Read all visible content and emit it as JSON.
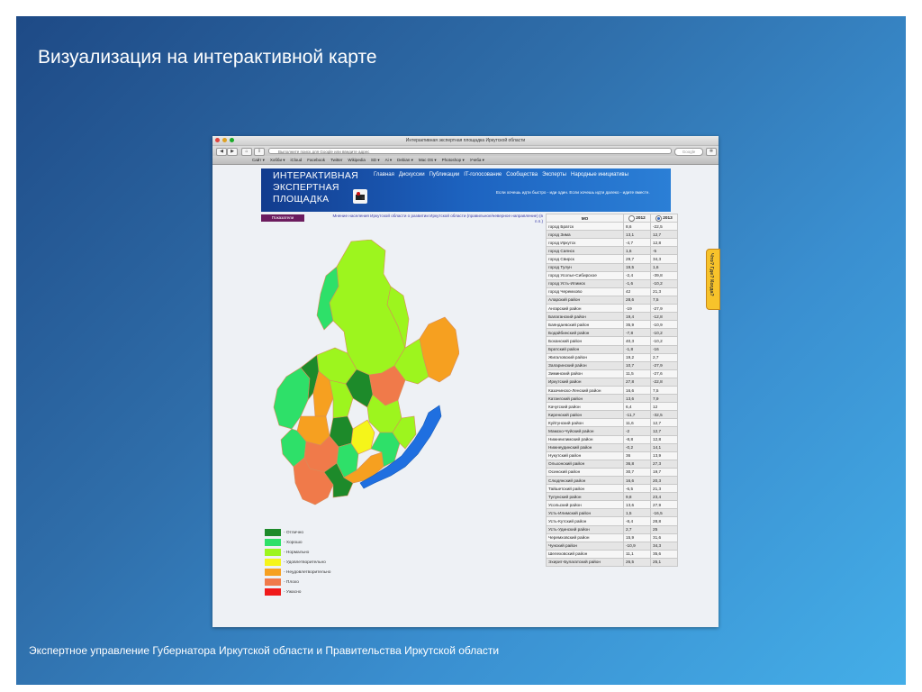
{
  "slide": {
    "title": "Визуализация на интерактивной карте",
    "footer": "Экспертное управление Губернатора Иркутской области и Правительства Иркутской области"
  },
  "browser": {
    "window_title": "Интерактивная экспертная площадка Иркутской области",
    "url_placeholder": "Выполните поиск для Google или введите адрес",
    "search_placeholder": "Google",
    "bookmarks": [
      "Сайт ▾",
      "Хобби ▾",
      "iCloud",
      "Facebook",
      "Twitter",
      "Wikipedia",
      "SD ▾",
      "Ai ▾",
      "Debian ▾",
      "Mac OS ▾",
      "Photoshop ▾",
      "Учеба ▾"
    ]
  },
  "site": {
    "logo_line1": "ИНТЕРАКТИВНАЯ",
    "logo_line2": "ЭКСПЕРТНАЯ",
    "logo_line3": "ПЛОЩАДКА",
    "nav": [
      "Главная",
      "Дискуссии",
      "Публикации",
      "IT-голосование",
      "Сообщества",
      "Эксперты",
      "Народные инициативы"
    ],
    "quote": "Если хочешь идти быстро - иди один. Если хочешь идти далеко - идите вместе.",
    "indicators_button": "Показатели",
    "map_heading": "Мнение населения Иркутской области о развитии Иркутской области (правильное/неверное направление) (в п.п.)",
    "side_tab": "Что? Где? Когда?"
  },
  "legend": [
    {
      "label": "- Отлично",
      "color": "#1d8a2a"
    },
    {
      "label": "- Хорошо",
      "color": "#2ee069"
    },
    {
      "label": "- Нормально",
      "color": "#9df51e"
    },
    {
      "label": "- Удовлетворительно",
      "color": "#f5f51a"
    },
    {
      "label": "- Неудовлетворительно",
      "color": "#f6a020"
    },
    {
      "label": "- Плохо",
      "color": "#f07a4a"
    },
    {
      "label": "- Ужасно",
      "color": "#f01a1a"
    }
  ],
  "table": {
    "header": {
      "mo": "МО",
      "y2012": "2012",
      "y2013": "2013"
    },
    "rows": [
      [
        "город Братск",
        "8,6",
        "-22,5"
      ],
      [
        "город Зима",
        "13,1",
        "12,7"
      ],
      [
        "город Иркутск",
        "-4,7",
        "12,8"
      ],
      [
        "город Саянск",
        "1,6",
        "-5"
      ],
      [
        "город Свирск",
        "29,7",
        "34,3"
      ],
      [
        "город Тулун",
        "19,5",
        "1,6"
      ],
      [
        "город Усолье-Сибирское",
        "-2,4",
        "-39,8"
      ],
      [
        "город Усть-Илимск",
        "-1,6",
        "-10,2"
      ],
      [
        "город Черемхово",
        "42",
        "21,3"
      ],
      [
        "Аларский район",
        "28,6",
        "7,5"
      ],
      [
        "Ангарский район",
        "-19",
        "-27,9"
      ],
      [
        "Балаганский район",
        "19,4",
        "-12,8"
      ],
      [
        "Баяндаевский район",
        "35,9",
        "-10,9"
      ],
      [
        "Бодайбинский район",
        "-7,8",
        "-10,2"
      ],
      [
        "Боханский район",
        "40,3",
        "-10,2"
      ],
      [
        "Братский район",
        "-1,8",
        "-16"
      ],
      [
        "Жигаловский район",
        "19,2",
        "2,7"
      ],
      [
        "Заларинский район",
        "10,7",
        "-27,9"
      ],
      [
        "Зиминский район",
        "11,5",
        "-27,6"
      ],
      [
        "Иркутский район",
        "27,8",
        "-22,8"
      ],
      [
        "Казачинско-Ленский район",
        "16,6",
        "7,5"
      ],
      [
        "Катангский район",
        "13,6",
        "7,9"
      ],
      [
        "Качугский район",
        "6,4",
        "12"
      ],
      [
        "Киренский район",
        "-11,7",
        "-32,5"
      ],
      [
        "Куйтунский район",
        "11,6",
        "12,7"
      ],
      [
        "Мамско-Чуйский район",
        "-2",
        "12,7"
      ],
      [
        "Нижнеилимский район",
        "-8,8",
        "12,8"
      ],
      [
        "Нижнеудинский район",
        "-0,2",
        "14,1"
      ],
      [
        "Нукутский район",
        "36",
        "13,9"
      ],
      [
        "Ольхонский район",
        "36,8",
        "27,3"
      ],
      [
        "Осинский район",
        "30,7",
        "19,7"
      ],
      [
        "Слюдянский район",
        "16,6",
        "20,3"
      ],
      [
        "Тайшетский район",
        "-6,5",
        "21,3"
      ],
      [
        "Тулунский район",
        "9,8",
        "23,4"
      ],
      [
        "Усольский район",
        "13,6",
        "27,9"
      ],
      [
        "Усть-Илимский район",
        "1,5",
        "-16,5"
      ],
      [
        "Усть-Кутский район",
        "-8,4",
        "28,8"
      ],
      [
        "Усть-Удинский район",
        "2,7",
        "25"
      ],
      [
        "Черемховский район",
        "15,9",
        "31,6"
      ],
      [
        "Чунский район",
        "-10,9",
        "34,3"
      ],
      [
        "Шелеховский район",
        "11,1",
        "35,6"
      ],
      [
        "Эхирит-Булагатский район",
        "26,5",
        "25,1"
      ]
    ]
  }
}
